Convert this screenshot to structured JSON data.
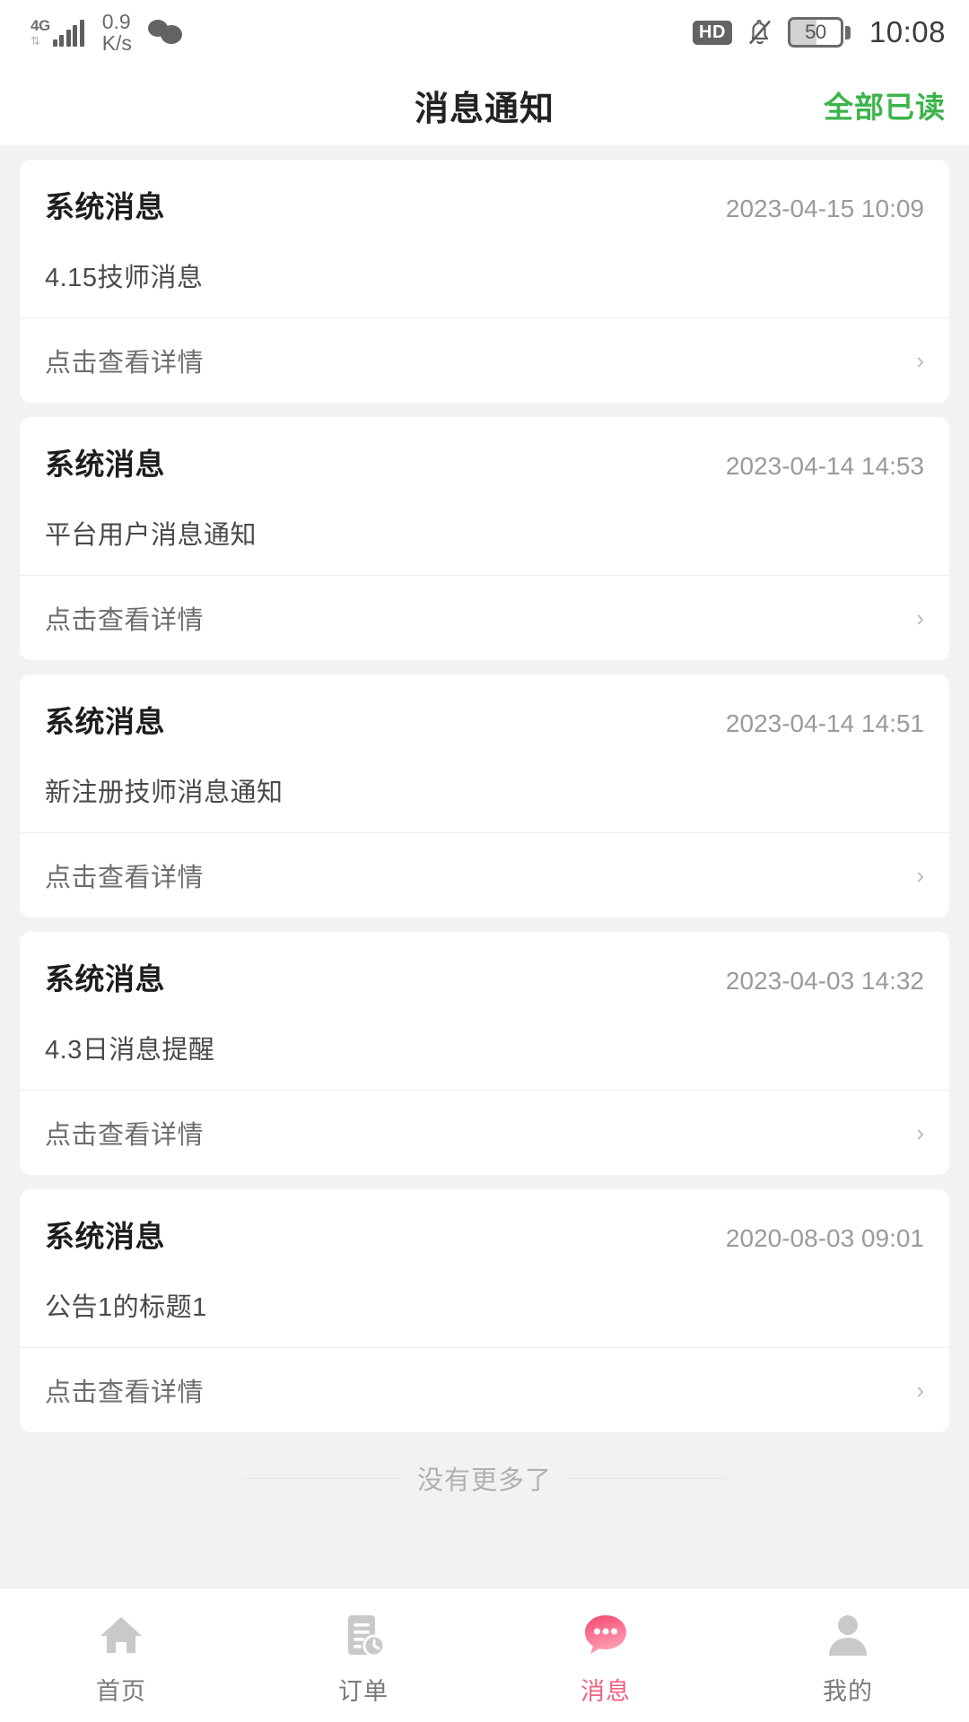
{
  "status_bar": {
    "network_type": "4G",
    "network_speed_value": "0.9",
    "network_speed_unit": "K/s",
    "wechat_icon": "wechat-icon",
    "hd_badge": "HD",
    "mute_icon": "bell-muted-icon",
    "battery_level": "50",
    "time": "10:08"
  },
  "header": {
    "title": "消息通知",
    "action_label": "全部已读",
    "action_color": "#3cb44a"
  },
  "messages": [
    {
      "title": "系统消息",
      "time": "2023-04-15 10:09",
      "body": "4.15技师消息",
      "detail_label": "点击查看详情",
      "chevron": "›"
    },
    {
      "title": "系统消息",
      "time": "2023-04-14 14:53",
      "body": "平台用户消息通知",
      "detail_label": "点击查看详情",
      "chevron": "›"
    },
    {
      "title": "系统消息",
      "time": "2023-04-14 14:51",
      "body": "新注册技师消息通知",
      "detail_label": "点击查看详情",
      "chevron": "›"
    },
    {
      "title": "系统消息",
      "time": "2023-04-03 14:32",
      "body": "4.3日消息提醒",
      "detail_label": "点击查看详情",
      "chevron": "›"
    },
    {
      "title": "系统消息",
      "time": "2020-08-03 09:01",
      "body": "公告1的标题1",
      "detail_label": "点击查看详情",
      "chevron": "›"
    }
  ],
  "list_end": {
    "text": "没有更多了"
  },
  "tabbar": {
    "active_color": "#f4607f",
    "inactive_color": "#c4c4c4",
    "items": [
      {
        "label": "首页",
        "icon": "home-icon",
        "active": false
      },
      {
        "label": "订单",
        "icon": "order-document-clock-icon",
        "active": false
      },
      {
        "label": "消息",
        "icon": "message-bubble-icon",
        "active": true
      },
      {
        "label": "我的",
        "icon": "profile-person-icon",
        "active": false
      }
    ]
  }
}
